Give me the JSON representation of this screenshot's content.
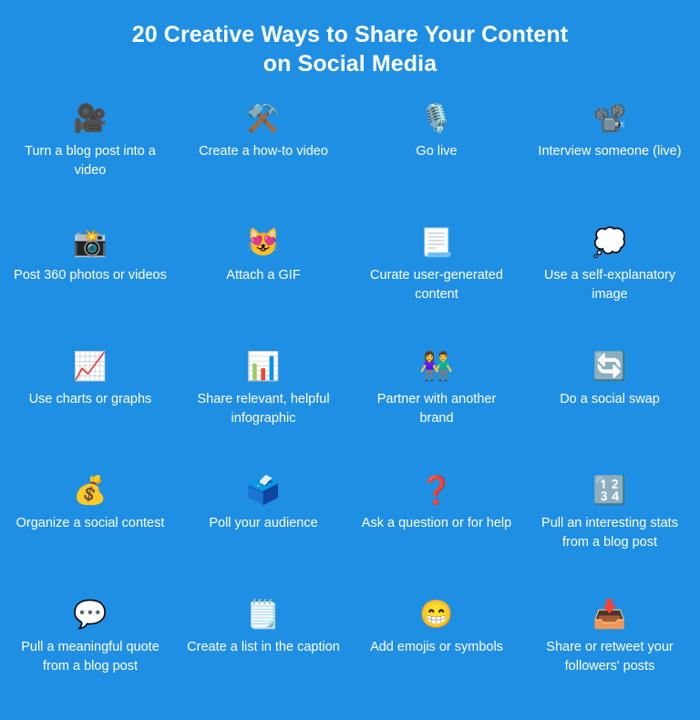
{
  "title": {
    "line1": "20 Creative Ways to Share Your Content",
    "line2": "on Social Media"
  },
  "colors": {
    "background": "#1f8fe3",
    "text": "#ffffff"
  },
  "items": [
    {
      "icon": "movie-camera-icon",
      "glyph": "🎥",
      "label": "Turn a blog post into a video"
    },
    {
      "icon": "hammer-and-pick-icon",
      "glyph": "⚒️",
      "label": "Create a how-to video"
    },
    {
      "icon": "studio-microphone-icon",
      "glyph": "🎙️",
      "label": "Go live"
    },
    {
      "icon": "film-projector-icon",
      "glyph": "📽️",
      "label": "Interview someone (live)"
    },
    {
      "icon": "camera-with-flash-icon",
      "glyph": "📸",
      "label": "Post 360 photos or videos"
    },
    {
      "icon": "smiling-cat-heart-eyes-icon",
      "glyph": "😻",
      "label": "Attach a GIF"
    },
    {
      "icon": "page-with-curl-icon",
      "glyph": "📃",
      "label": "Curate user-generated content"
    },
    {
      "icon": "thought-balloon-icon",
      "glyph": "💭",
      "label": "Use a self-explanatory image"
    },
    {
      "icon": "chart-increasing-icon",
      "glyph": "📈",
      "label": "Use charts or graphs"
    },
    {
      "icon": "bar-chart-icon",
      "glyph": "📊",
      "label": "Share relevant, helpful infographic"
    },
    {
      "icon": "two-people-holding-hands-icon",
      "glyph": "👫",
      "label": "Partner with another brand"
    },
    {
      "icon": "counterclockwise-arrows-icon",
      "glyph": "🔄",
      "label": "Do a social swap"
    },
    {
      "icon": "money-bag-icon",
      "glyph": "💰",
      "label": "Organize a social contest"
    },
    {
      "icon": "ballot-box-with-ballot-icon",
      "glyph": "🗳️",
      "label": "Poll your audience"
    },
    {
      "icon": "red-question-mark-icon",
      "glyph": "❓",
      "label": "Ask a question or for help"
    },
    {
      "icon": "input-numbers-icon",
      "glyph": "🔢",
      "label": "Pull an interesting stats from a blog post"
    },
    {
      "icon": "speech-balloon-icon",
      "glyph": "💬",
      "label": "Pull a meaningful quote from a blog post"
    },
    {
      "icon": "spiral-notepad-icon",
      "glyph": "🗒️",
      "label": "Create a list in the caption"
    },
    {
      "icon": "grinning-face-icon",
      "glyph": "😁",
      "label": "Add emojis or symbols"
    },
    {
      "icon": "inbox-tray-icon",
      "glyph": "📥",
      "label": "Share or retweet your followers' posts"
    }
  ]
}
